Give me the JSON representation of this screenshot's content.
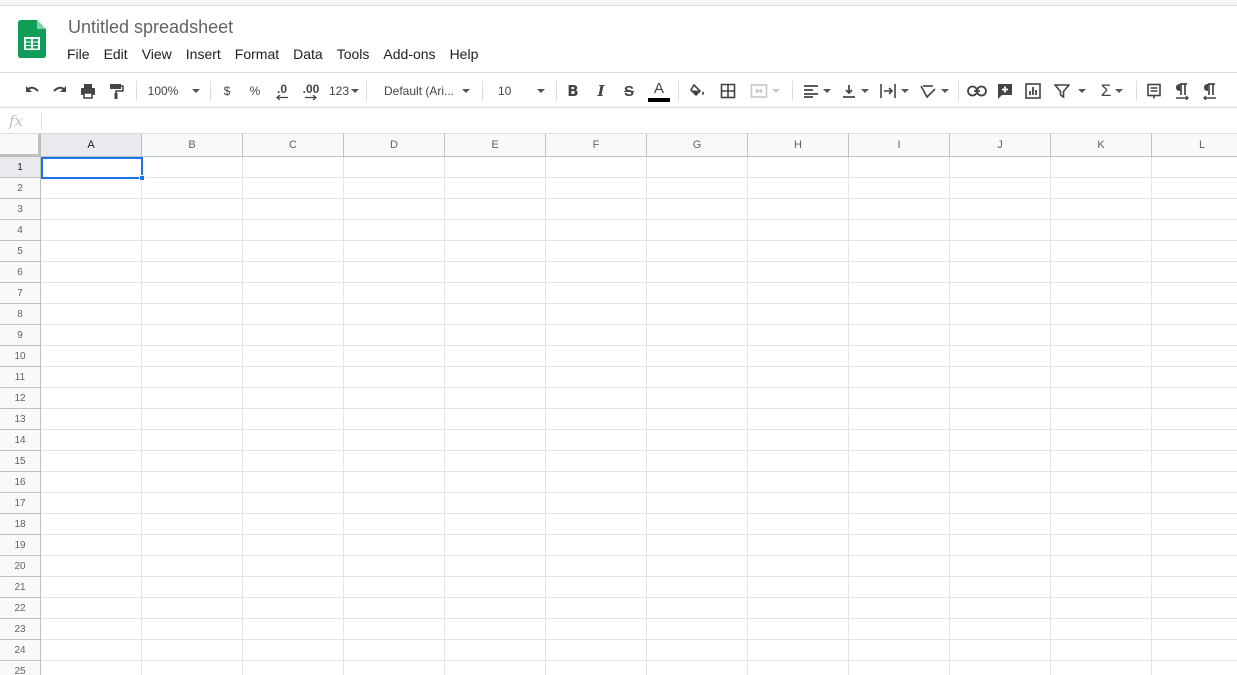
{
  "app": {
    "document_title": "Untitled spreadsheet",
    "brand_color": "#0f9d58"
  },
  "menu": {
    "items": [
      "File",
      "Edit",
      "View",
      "Insert",
      "Format",
      "Data",
      "Tools",
      "Add-ons",
      "Help"
    ]
  },
  "toolbar": {
    "zoom": "100%",
    "currency": "$",
    "percent": "%",
    "decrease_decimal": ".0",
    "increase_decimal": ".00",
    "more_formats": "123",
    "font_family": "Default (Ari...",
    "font_size": "10",
    "bold": "B",
    "italic": "I",
    "strikethrough": "S",
    "text_color_letter": "A",
    "text_color": "#000000",
    "sum_symbol": "Σ"
  },
  "formula_bar": {
    "fx_label": "fx",
    "value": ""
  },
  "grid": {
    "columns": [
      "A",
      "B",
      "C",
      "D",
      "E",
      "F",
      "G",
      "H",
      "I",
      "J",
      "K",
      "L"
    ],
    "rows": [
      "1",
      "2",
      "3",
      "4",
      "5",
      "6",
      "7",
      "8",
      "9",
      "10",
      "11",
      "12",
      "13",
      "14",
      "15",
      "16",
      "17",
      "18",
      "19",
      "20",
      "21",
      "22",
      "23",
      "24",
      "25"
    ],
    "selected_cell": "A1",
    "selection_color": "#1a73e8"
  }
}
